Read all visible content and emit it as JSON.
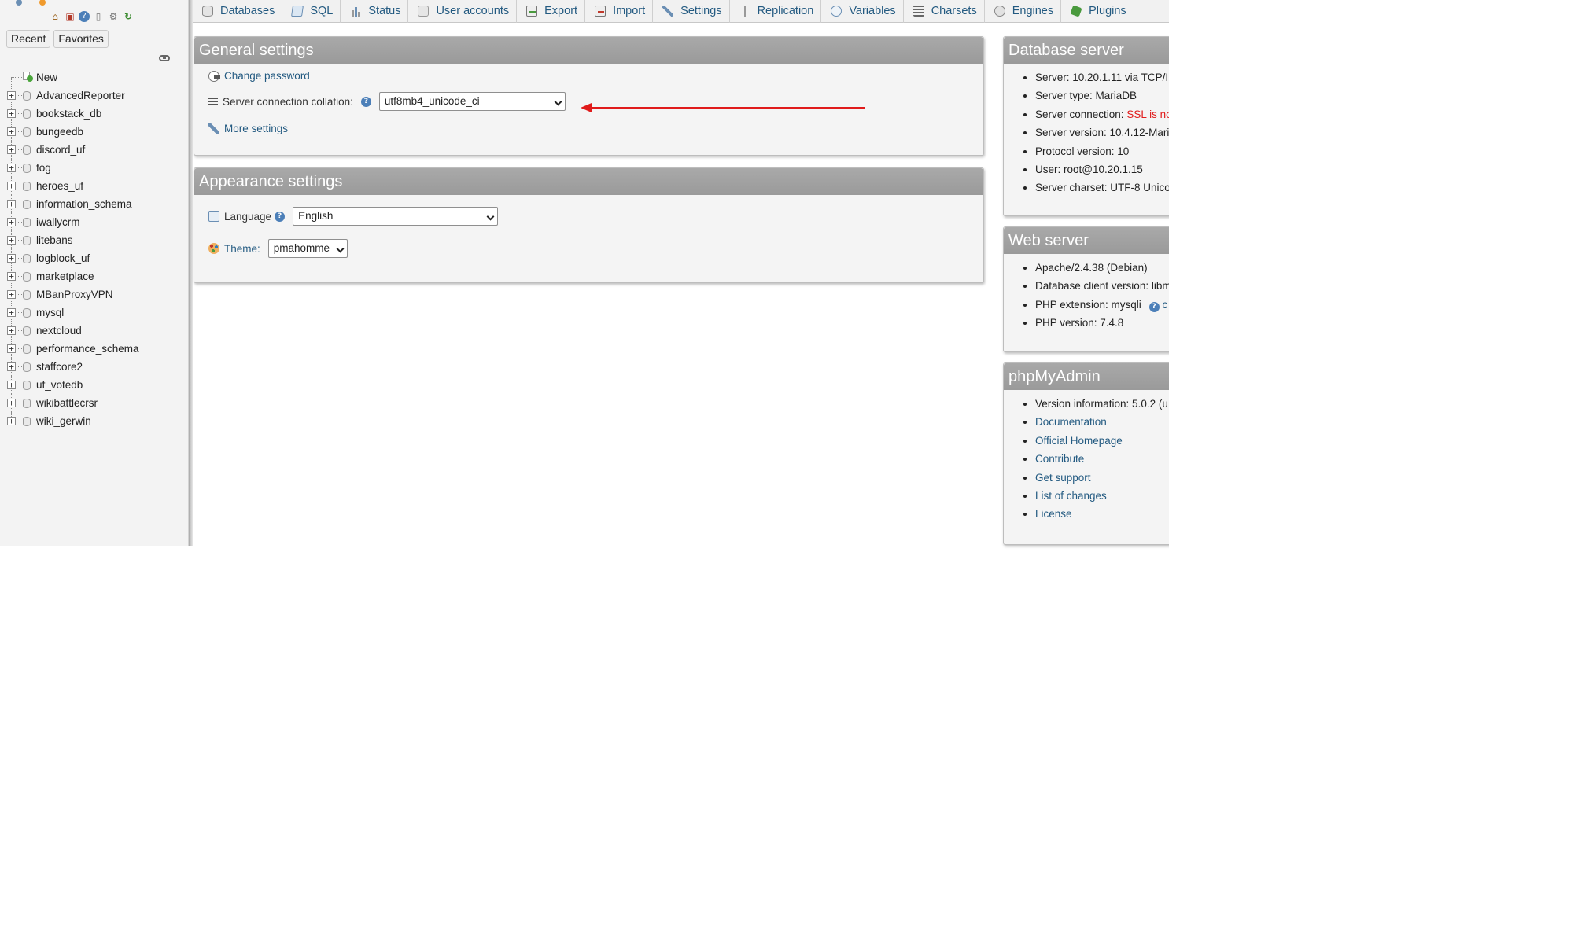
{
  "sidebar": {
    "nav_icons": [
      "home-icon",
      "logout-icon",
      "help-icon",
      "documentation-icon",
      "settings-icon",
      "reload-icon"
    ],
    "recent_label": "Recent",
    "favorites_label": "Favorites",
    "new_label": "New",
    "databases": [
      "AdvancedReporter",
      "bookstack_db",
      "bungeedb",
      "discord_uf",
      "fog",
      "heroes_uf",
      "information_schema",
      "iwallycrm",
      "litebans",
      "logblock_uf",
      "marketplace",
      "MBanProxyVPN",
      "mysql",
      "nextcloud",
      "performance_schema",
      "staffcore2",
      "uf_votedb",
      "wikibattlecrsr",
      "wiki_gerwin"
    ]
  },
  "topmenu": {
    "tabs": [
      {
        "label": "Databases",
        "icon": "database-icon"
      },
      {
        "label": "SQL",
        "icon": "sql-icon"
      },
      {
        "label": "Status",
        "icon": "status-icon"
      },
      {
        "label": "User accounts",
        "icon": "user-accounts-icon"
      },
      {
        "label": "Export",
        "icon": "export-icon"
      },
      {
        "label": "Import",
        "icon": "import-icon"
      },
      {
        "label": "Settings",
        "icon": "settings-icon"
      },
      {
        "label": "Replication",
        "icon": "replication-icon"
      },
      {
        "label": "Variables",
        "icon": "variables-icon"
      },
      {
        "label": "Charsets",
        "icon": "charsets-icon"
      },
      {
        "label": "Engines",
        "icon": "engines-icon"
      },
      {
        "label": "Plugins",
        "icon": "plugins-icon"
      }
    ]
  },
  "general_settings": {
    "title": "General settings",
    "change_password": "Change password",
    "collation_label": "Server connection collation:",
    "collation_value": "utf8mb4_unicode_ci",
    "more_settings": "More settings"
  },
  "appearance_settings": {
    "title": "Appearance settings",
    "language_label": "Language",
    "language_value": "English",
    "theme_label": "Theme:",
    "theme_value": "pmahomme"
  },
  "database_server": {
    "title": "Database server",
    "items": [
      {
        "text": "Server: 10.20.1.11 via TCP/I"
      },
      {
        "text": "Server type: MariaDB"
      },
      {
        "label": "Server connection: ",
        "warning": "SSL is no"
      },
      {
        "text": "Server version: 10.4.12-Mari"
      },
      {
        "text": "Protocol version: 10"
      },
      {
        "text": "User: root@10.20.1.15"
      },
      {
        "text": "Server charset: UTF-8 Unico"
      }
    ]
  },
  "web_server": {
    "title": "Web server",
    "items": [
      "Apache/2.4.38 (Debian)",
      "Database client version: libm",
      "PHP extension: mysqli",
      "PHP version: 7.4.8"
    ],
    "ext_trailing": "c"
  },
  "phpmyadmin": {
    "title": "phpMyAdmin",
    "version": "Version information: 5.0.2 (u",
    "links": [
      "Documentation",
      "Official Homepage",
      "Contribute",
      "Get support",
      "List of changes",
      "License"
    ]
  },
  "colors": {
    "link": "#235a81",
    "panel_header": "#9f9f9f",
    "warning": "#e01b1b",
    "annotation_arrow": "#e01b1b"
  }
}
